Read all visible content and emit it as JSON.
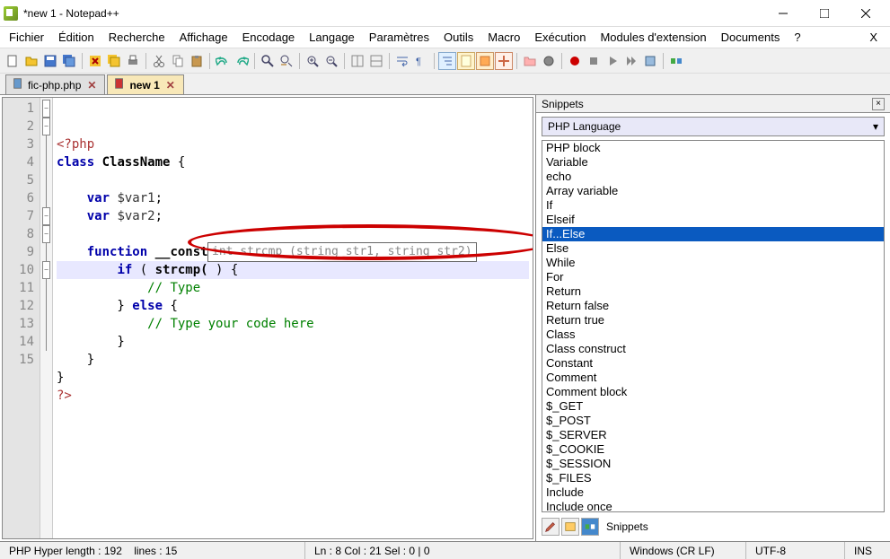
{
  "titlebar": {
    "title": "*new 1 - Notepad++"
  },
  "menu": [
    "Fichier",
    "Édition",
    "Recherche",
    "Affichage",
    "Encodage",
    "Langage",
    "Paramètres",
    "Outils",
    "Macro",
    "Exécution",
    "Modules d'extension",
    "Documents",
    "?"
  ],
  "tabs": [
    {
      "name": "fic-php.php",
      "active": false
    },
    {
      "name": "new 1",
      "active": true
    }
  ],
  "code": {
    "lines": [
      {
        "n": 1,
        "fold": "minus",
        "html": "<span class='php'>&lt;?php</span>"
      },
      {
        "n": 2,
        "fold": "minus",
        "html": "<span class='kw'>class</span> <span class='fn'>ClassName</span> {"
      },
      {
        "n": 3,
        "fold": "line",
        "html": ""
      },
      {
        "n": 4,
        "fold": "line",
        "html": "    <span class='kw'>var</span> <span class='var'>$var1</span>;"
      },
      {
        "n": 5,
        "fold": "line",
        "html": "    <span class='kw'>var</span> <span class='var'>$var2</span>;"
      },
      {
        "n": 6,
        "fold": "line",
        "html": ""
      },
      {
        "n": 7,
        "fold": "minus",
        "html": "    <span class='kw'>function</span> <span class='fn'>__construct</span>(argument) {"
      },
      {
        "n": 8,
        "fold": "minus",
        "hl": true,
        "html": "        <span class='kw'>if</span> ( <span class='fn'>strcmp(</span> ) {"
      },
      {
        "n": 9,
        "fold": "line",
        "html": "            <span class='cmt'>// Type</span>"
      },
      {
        "n": 10,
        "fold": "minus",
        "html": "        } <span class='kw'>else</span> {"
      },
      {
        "n": 11,
        "fold": "line",
        "html": "            <span class='cmt'>// Type your code here</span>"
      },
      {
        "n": 12,
        "fold": "line",
        "html": "        }"
      },
      {
        "n": 13,
        "fold": "line",
        "html": "    }"
      },
      {
        "n": 14,
        "fold": "line",
        "html": "}"
      },
      {
        "n": 15,
        "fold": "",
        "html": "<span class='php'>?&gt;</span>"
      }
    ],
    "tooltip": "int strcmp (string str1, string str2)"
  },
  "snippets": {
    "title": "Snippets",
    "language": "PHP Language",
    "items": [
      "PHP block",
      "Variable",
      "echo",
      "Array variable",
      "If",
      "Elseif",
      {
        "label": "If...Else",
        "selected": true
      },
      "Else",
      "While",
      "For",
      "Return",
      "Return false",
      "Return true",
      "Class",
      "Class construct",
      "Constant",
      "Comment",
      "Comment block",
      "$_GET",
      "$_POST",
      "$_SERVER",
      "$_COOKIE",
      "$_SESSION",
      "$_FILES",
      "Include",
      "Include once"
    ],
    "bottom_label": "Snippets"
  },
  "statusbar": {
    "lang": "PHP Hyper",
    "length": "length : 192",
    "lines": "lines : 15",
    "pos": "Ln : 8    Col : 21    Sel : 0 | 0",
    "eol": "Windows (CR LF)",
    "enc": "UTF-8",
    "mode": "INS"
  }
}
